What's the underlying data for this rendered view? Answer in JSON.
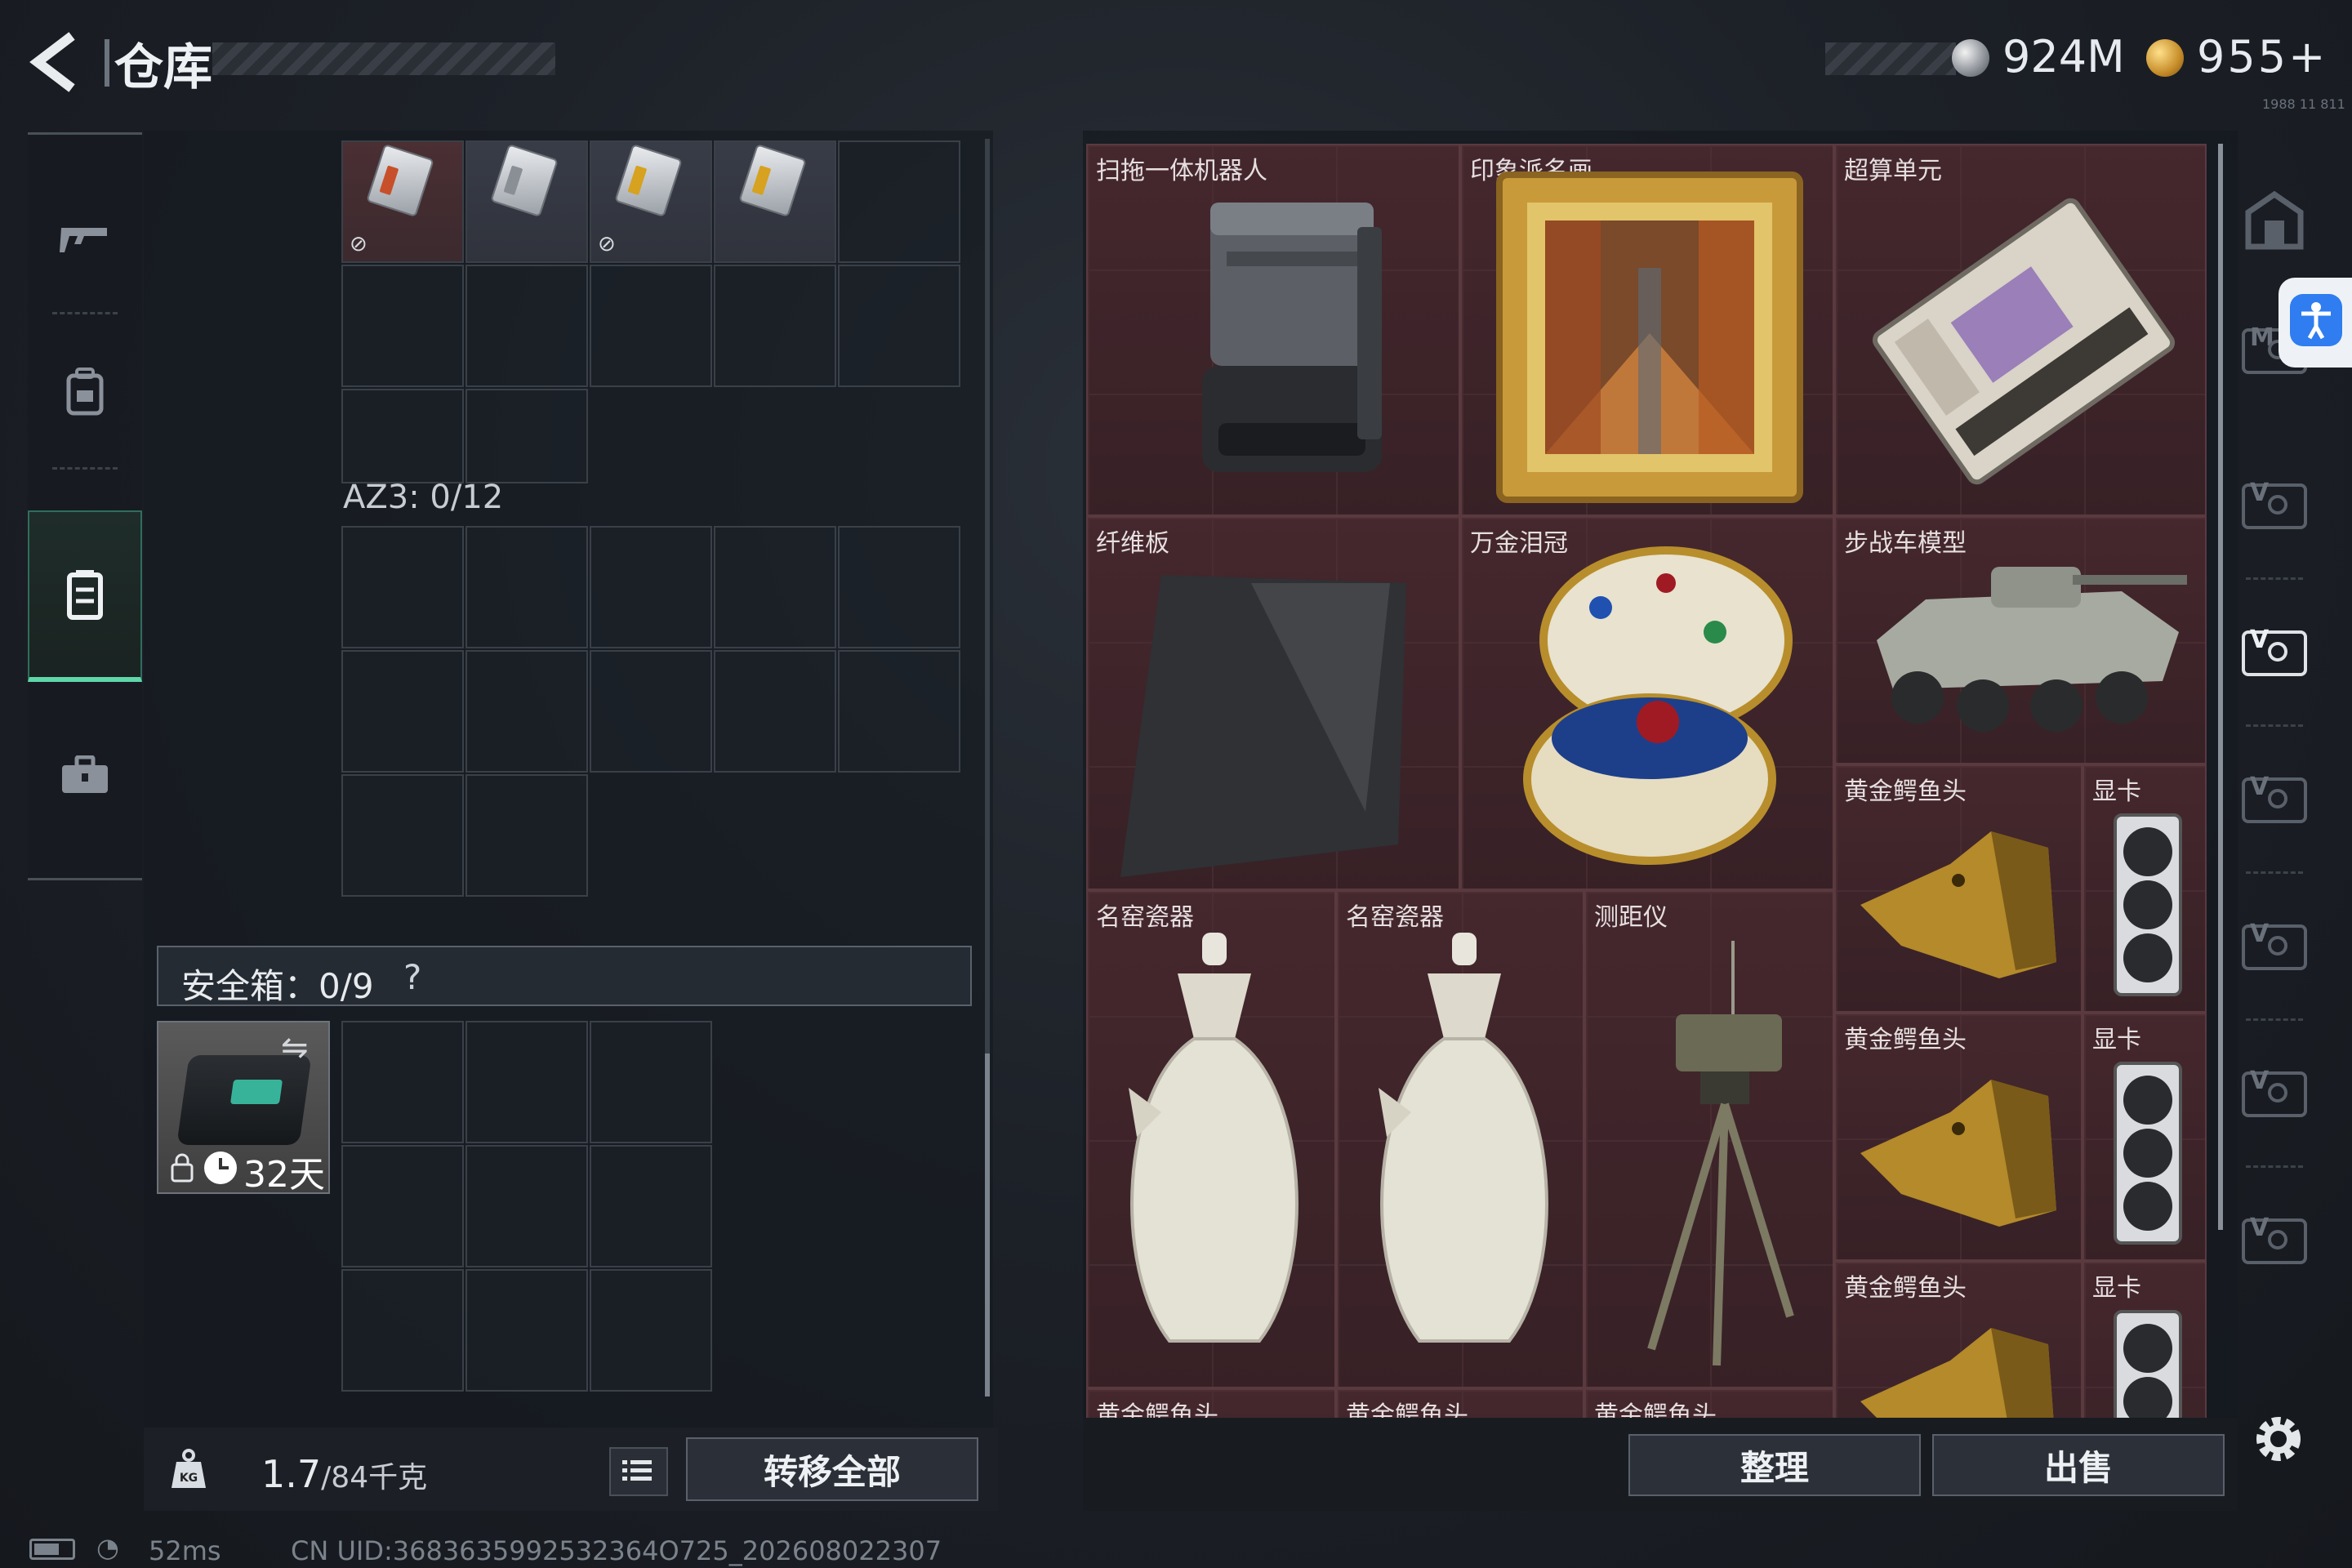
{
  "header": {
    "title": "仓库",
    "currency_a": "924M",
    "currency_b": "955+",
    "tiny_status": "1988 11 811"
  },
  "sidebar": {
    "items": [
      {
        "icon": "gun-icon"
      },
      {
        "icon": "backpack-icon"
      },
      {
        "icon": "container-icon",
        "active": true
      },
      {
        "icon": "briefcase-icon"
      }
    ]
  },
  "left": {
    "az3_label": "AZ3: 0/12",
    "safe_box_label": "安全箱：0/9",
    "safe_help": "?",
    "safe_days": "32天"
  },
  "weight": {
    "current": "1.7",
    "max_unit": "/84千克"
  },
  "buttons": {
    "transfer_all": "转移全部",
    "sort": "整理",
    "sell": "出售"
  },
  "items": [
    {
      "label": "扫拖一体机器人"
    },
    {
      "label": "印象派名画"
    },
    {
      "label": "超算单元"
    },
    {
      "label": "纤维板"
    },
    {
      "label": "万金泪冠"
    },
    {
      "label": "步战车模型"
    },
    {
      "label": "黄金鳄鱼头"
    },
    {
      "label": "显卡"
    },
    {
      "label": "名窑瓷器"
    },
    {
      "label": "名窑瓷器"
    },
    {
      "label": "测距仪"
    },
    {
      "label": "黄金鳄鱼头"
    },
    {
      "label": "显卡"
    },
    {
      "label": "黄金鳄鱼头"
    },
    {
      "label": "显卡"
    },
    {
      "label": "黄金鳄鱼头"
    },
    {
      "label": "黄金鳄鱼头"
    },
    {
      "label": "黄金鳄鱼头"
    }
  ],
  "status": {
    "ping": "52ms",
    "uid": "CN UID:3683635992532364O725_202608022307"
  }
}
